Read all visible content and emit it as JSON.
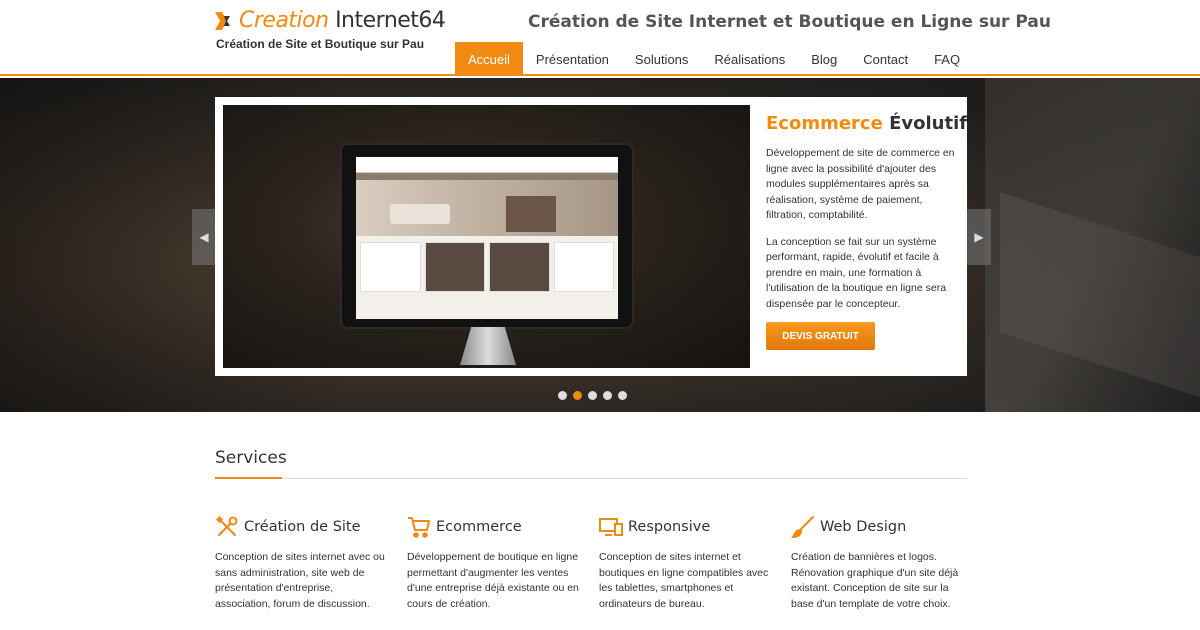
{
  "header": {
    "logo_part1": "Creation",
    "logo_part2": " Internet64",
    "tagline": "Création de Site et Boutique sur Pau",
    "site_title": "Création de Site Internet et Boutique en Ligne sur Pau",
    "nav": [
      {
        "label": "Accueil",
        "active": true
      },
      {
        "label": "Présentation"
      },
      {
        "label": "Solutions"
      },
      {
        "label": "Réalisations"
      },
      {
        "label": "Blog"
      },
      {
        "label": "Contact"
      },
      {
        "label": "FAQ"
      }
    ]
  },
  "slider": {
    "title_accent": "Ecommerce",
    "title_rest": " Évolutif",
    "paragraphs": [
      "Développement de site de commerce en ligne avec la possibilité d'ajouter des modules supplémentaires après sa réalisation, système de paiement, filtration, comptabilité.",
      "La conception se fait sur un système performant, rapide, évolutif et facile à prendre en main, une formation à l'utilisation de la boutique en ligne sera dispensée par le concepteur."
    ],
    "button_label": "DEVIS GRATUIT",
    "prev_glyph": "◀",
    "next_glyph": "▶",
    "dots_count": 5,
    "active_dot": 1
  },
  "services": {
    "title": "Services",
    "items": [
      {
        "title": "Création de Site",
        "icon": "tools-icon",
        "desc": "Conception de sites internet avec ou sans administration, site web de présentation d'entreprise, association, forum de discussion."
      },
      {
        "title": "Ecommerce",
        "icon": "cart-icon",
        "desc": "Développement de boutique en ligne permettant d'augmenter les ventes d'une entreprise déjà existante ou en cours de création."
      },
      {
        "title": "Responsive",
        "icon": "devices-icon",
        "desc": "Conception de sites internet et boutiques en ligne compatibles avec les tablettes, smartphones et ordinateurs de bureau."
      },
      {
        "title": "Web Design",
        "icon": "brush-icon",
        "desc": "Création de bannières et logos. Rénovation graphique d'un site déjà existant. Conception de site sur la base d'un template de votre choix."
      }
    ]
  },
  "colors": {
    "accent": "#f08a10",
    "text": "#333333"
  }
}
